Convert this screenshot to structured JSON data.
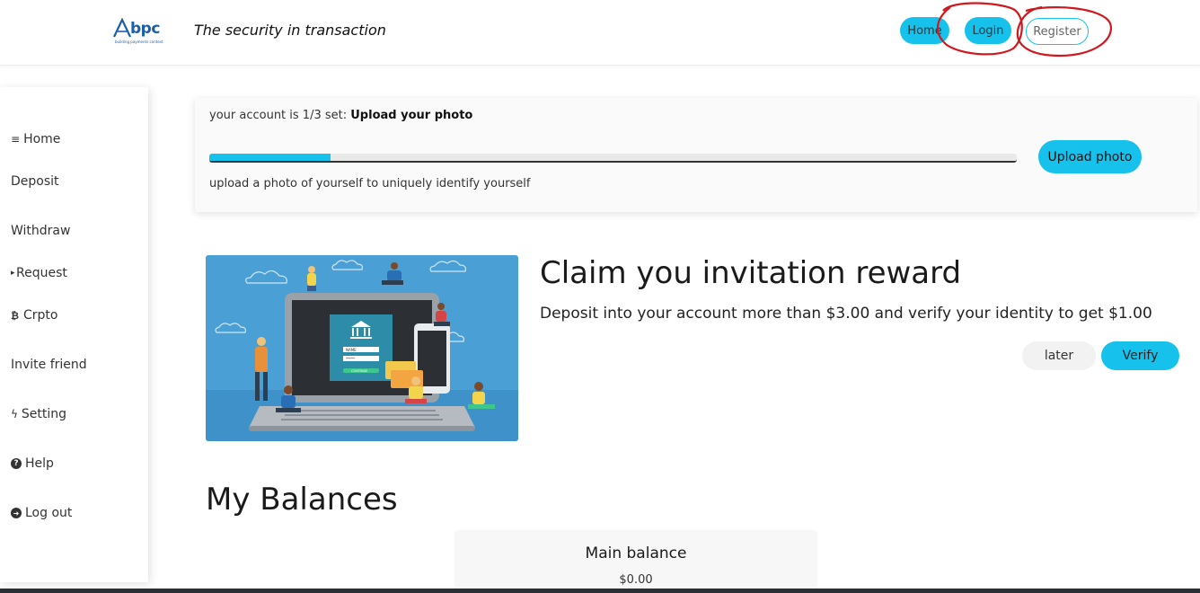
{
  "header": {
    "logo_text": "bpc",
    "logo_subtext": "building payments context",
    "tagline": "The security in transaction",
    "nav": {
      "home": "Home",
      "login": "Login",
      "register": "Register"
    }
  },
  "sidebar": {
    "items": [
      {
        "icon": "menu-icon",
        "glyph": "≡",
        "label": "Home"
      },
      {
        "icon": "",
        "glyph": "",
        "label": "Deposit"
      },
      {
        "icon": "",
        "glyph": "",
        "label": "Withdraw"
      },
      {
        "icon": "caret-right-icon",
        "glyph": "▸",
        "label": "Request"
      },
      {
        "icon": "bitcoin-icon",
        "glyph": "₿",
        "label": "Crpto"
      },
      {
        "icon": "",
        "glyph": "",
        "label": "Invite friend"
      },
      {
        "icon": "bolt-icon",
        "glyph": "ϟ",
        "label": "Setting"
      },
      {
        "icon": "question-circle-icon",
        "glyph": "?",
        "label": "Help"
      },
      {
        "icon": "arrow-circle-right-icon",
        "glyph": "➜",
        "label": "Log out"
      }
    ]
  },
  "account_progress": {
    "prefix": "your account is 1/3 set: ",
    "step": "Upload your photo",
    "progress_fraction": 0.15,
    "description": "upload a photo of yourself to uniquely identify yourself",
    "button": "Upload photo"
  },
  "promo": {
    "title": "Claim you invitation reward",
    "description": "Deposit into your account more than $3.00 and verify your identity to get $1.00",
    "later_button": "later",
    "verify_button": "Verify",
    "illustration_field_1": "NAME",
    "illustration_field_2": "*****",
    "illustration_button": "CONTINUE"
  },
  "balances": {
    "heading": "My Balances",
    "main_label": "Main balance",
    "main_value": "$0.00"
  },
  "colors": {
    "accent": "#16c2ec",
    "annotation": "#d0191f",
    "illustration_bg": "#4a9fd4"
  }
}
